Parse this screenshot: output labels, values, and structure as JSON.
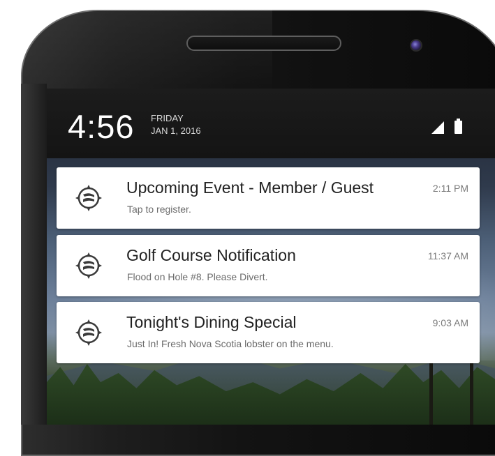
{
  "status_bar": {
    "time": "4:56",
    "day": "FRIDAY",
    "date": "JAN 1, 2016",
    "icons": [
      "signal-icon",
      "battery-icon"
    ]
  },
  "notifications": [
    {
      "icon": "golf-compass-icon",
      "title": "Upcoming Event - Member / Guest",
      "subtitle": "Tap to register.",
      "time": "2:11 PM"
    },
    {
      "icon": "golf-compass-icon",
      "title": "Golf Course Notification",
      "subtitle": "Flood on Hole #8. Please Divert.",
      "time": "11:37 AM"
    },
    {
      "icon": "golf-compass-icon",
      "title": "Tonight's Dining Special",
      "subtitle": "Just In! Fresh Nova Scotia lobster on the menu.",
      "time": "9:03 AM"
    }
  ],
  "colors": {
    "card_background": "#ffffff",
    "title_text": "#212121",
    "subtitle_text": "#6b6b6b",
    "status_bar": "#141414"
  }
}
